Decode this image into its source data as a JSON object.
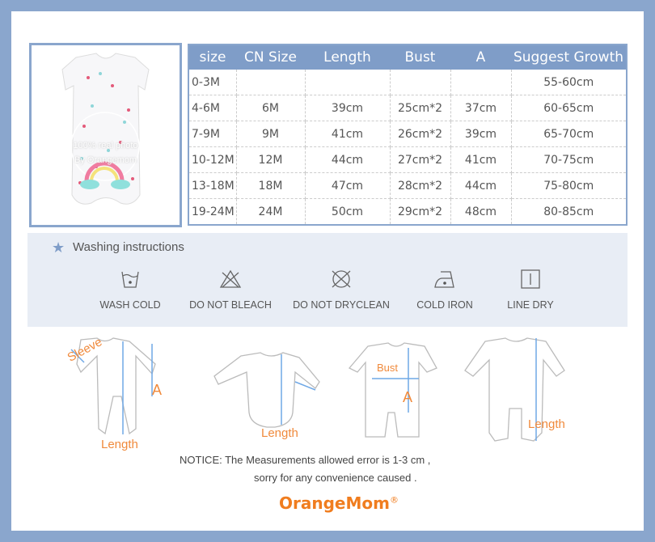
{
  "photo": {
    "watermark_line1": "100% real photo",
    "watermark_line2": "By Orangemom"
  },
  "size_table": {
    "headers": [
      "size",
      "CN Size",
      "Length",
      "Bust",
      "A",
      "Suggest Growth"
    ],
    "rows": [
      [
        "0-3M",
        "",
        "",
        "",
        "",
        "55-60cm"
      ],
      [
        "4-6M",
        "6M",
        "39cm",
        "25cm*2",
        "37cm",
        "60-65cm"
      ],
      [
        "7-9M",
        "9M",
        "41cm",
        "26cm*2",
        "39cm",
        "65-70cm"
      ],
      [
        "10-12M",
        "12M",
        "44cm",
        "27cm*2",
        "41cm",
        "70-75cm"
      ],
      [
        "13-18M",
        "18M",
        "47cm",
        "28cm*2",
        "44cm",
        "75-80cm"
      ],
      [
        "19-24M",
        "24M",
        "50cm",
        "29cm*2",
        "48cm",
        "80-85cm"
      ]
    ]
  },
  "washing": {
    "title": "Washing instructions",
    "items": [
      {
        "icon": "wash-cold-icon",
        "label": "WASH COLD"
      },
      {
        "icon": "do-not-bleach-icon",
        "label": "DO NOT BLEACH"
      },
      {
        "icon": "do-not-dryclean-icon",
        "label": "DO NOT DRYCLEAN"
      },
      {
        "icon": "cold-iron-icon",
        "label": "COLD IRON"
      },
      {
        "icon": "line-dry-icon",
        "label": "LINE DRY"
      }
    ]
  },
  "diagram_labels": {
    "sleeve": "Sleeve",
    "length": "Length",
    "a": "A",
    "bust": "Bust"
  },
  "notice": {
    "line1": "NOTICE:   The Measurements allowed error is 1-3 cm ,",
    "line2": "sorry for any convenience caused ."
  },
  "brand": {
    "name": "OrangeMom",
    "mark": "®"
  },
  "colors": {
    "frame": "#8aa6cd",
    "header": "#7f9dc8",
    "accent": "#f08a3c",
    "measure": "#6fa8e6"
  }
}
